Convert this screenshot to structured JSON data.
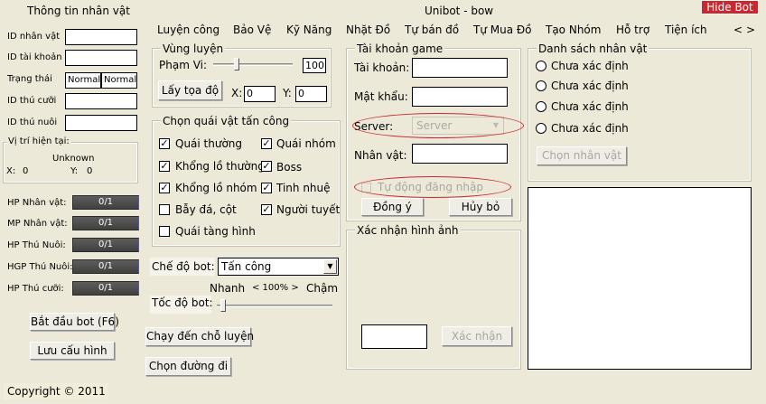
{
  "window": {
    "title": "Unibot - bow",
    "hide_bot_label": "Hide Bot"
  },
  "left_panel": {
    "title": "Thông tin nhân vật",
    "fields": [
      {
        "label": "ID nhân vật",
        "value": ""
      },
      {
        "label": "ID tài khoản",
        "value": ""
      },
      {
        "label": "Trạng thái",
        "value_1": "Normal",
        "value_2": "Normal"
      },
      {
        "label": "ID thú cưỡi",
        "value": ""
      },
      {
        "label": "ID thú nuôi",
        "value": ""
      }
    ],
    "position": {
      "label": "Vị trí hiện tại:",
      "location": "Unknown",
      "x_label": "X:",
      "x_value": "0",
      "y_label": "Y:",
      "y_value": "0"
    },
    "bars": [
      {
        "label": "HP Nhân vật:",
        "value": "0/1"
      },
      {
        "label": "MP Nhân vật:",
        "value": "0/1"
      },
      {
        "label": "HP Thú Nuôi:",
        "value": "0/1"
      },
      {
        "label": "HGP Thú Nuôi:",
        "value": "0/1"
      },
      {
        "label": "HP Thú cưỡi:",
        "value": "0/1"
      }
    ],
    "start_button": "Bắt đầu bot (F6)",
    "save_button": "Lưu cấu hình",
    "copyright": "Copyright © 2011"
  },
  "tabs": [
    "Luyện công",
    "Bảo Vệ",
    "Kỹ Năng",
    "Nhặt Đồ",
    "Tự bán đồ",
    "Tự Mua Đồ",
    "Tạo Nhóm",
    "Hỗ trợ",
    "Tiện ích"
  ],
  "tab_arrows": {
    "left": "<",
    "right": ">"
  },
  "training_zone": {
    "title": "Vùng luyện",
    "range_label": "Phạm Vi:",
    "range_value": "100",
    "get_coords_button": "Lấy tọa độ",
    "x_label": "X:",
    "x_value": "0",
    "y_label": "Y:",
    "y_value": "0"
  },
  "monster_select": {
    "title": "Chọn quái vật tấn công",
    "options": [
      {
        "label": "Quái thường",
        "checked": true
      },
      {
        "label": "Quái nhóm",
        "checked": true
      },
      {
        "label": "Khổng lồ thường",
        "checked": true
      },
      {
        "label": "Boss",
        "checked": true
      },
      {
        "label": "Khổng lồ nhóm",
        "checked": true
      },
      {
        "label": "Tinh nhuệ",
        "checked": true
      },
      {
        "label": "Bẫy đá, cột",
        "checked": false
      },
      {
        "label": "Người tuyết",
        "checked": true
      },
      {
        "label": "Quái tàng hình",
        "checked": false
      }
    ]
  },
  "bot_mode": {
    "label": "Chế độ bot:",
    "value": "Tấn công"
  },
  "speed": {
    "label": "Tốc độ bot:",
    "fast_label": "Nhanh",
    "percent_label": "< 100% >",
    "slow_label": "Chậm"
  },
  "run_to_training_button": "Chạy đến chỗ luyện",
  "choose_path_button": "Chọn đường đi",
  "account": {
    "title": "Tài khoản game",
    "username_label": "Tài khoản:",
    "username_value": "",
    "password_label": "Mật khẩu:",
    "password_value": "",
    "server_label": "Server:",
    "server_value": "Server",
    "character_label": "Nhân vật:",
    "character_value": "",
    "auto_login_label": "Tự động đăng nhập",
    "ok_button": "Đồng ý",
    "cancel_button": "Hủy bỏ"
  },
  "captcha": {
    "title": "Xác nhận hình ảnh",
    "confirm_button": "Xác nhận"
  },
  "characters": {
    "title": "Danh sách nhân vật",
    "items": [
      "Chưa xác định",
      "Chưa xác định",
      "Chưa xác định",
      "Chưa xác định"
    ],
    "select_button": "Chọn nhân vật"
  },
  "colors": {
    "background": "#ECE9D8",
    "accent_red": "#c8282e",
    "hide_bot_bg": "#c8282e"
  }
}
